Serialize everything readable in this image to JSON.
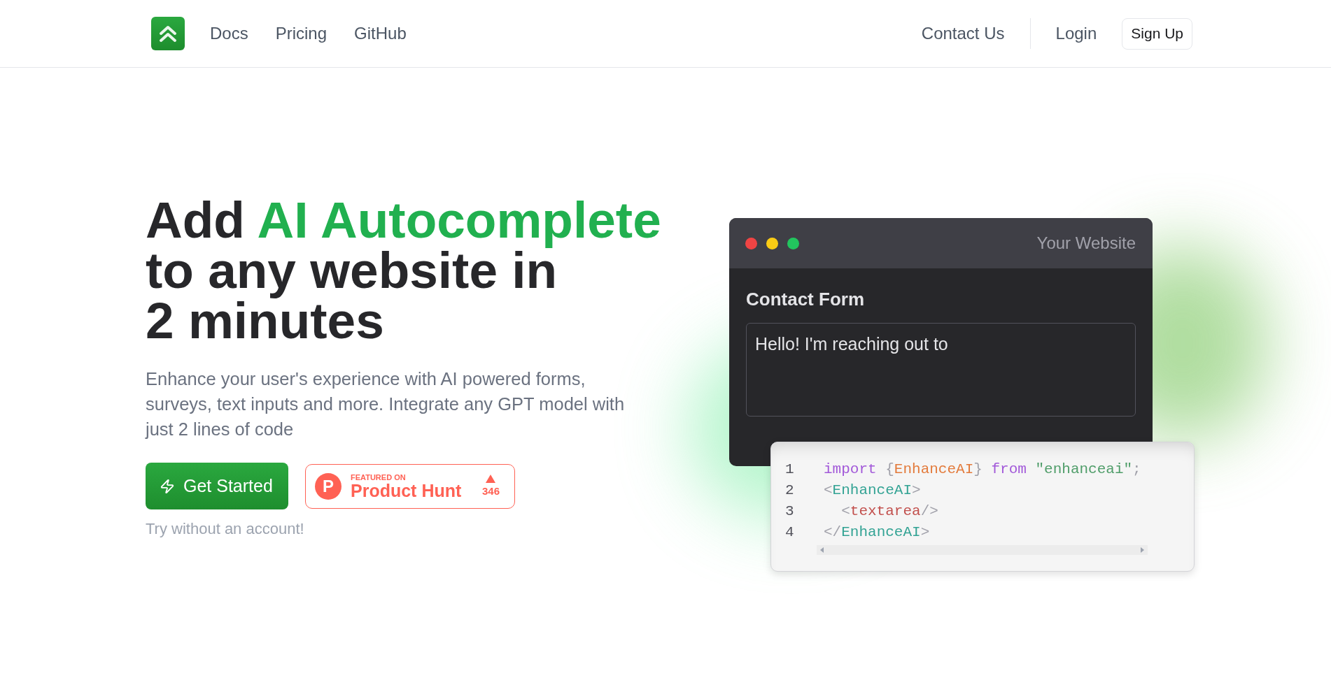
{
  "nav": {
    "links": [
      {
        "label": "Docs"
      },
      {
        "label": "Pricing"
      },
      {
        "label": "GitHub"
      }
    ],
    "contact": "Contact Us",
    "login": "Login",
    "signup": "Sign Up"
  },
  "hero": {
    "title_lines": [
      {
        "parts": [
          {
            "text": "Add ",
            "highlight": false
          },
          {
            "text": "AI Autocomplete",
            "highlight": true
          }
        ]
      },
      {
        "parts": [
          {
            "text": "to any website in",
            "highlight": false
          }
        ]
      },
      {
        "parts": [
          {
            "text": "2 minutes",
            "highlight": false
          }
        ]
      }
    ],
    "subtitle": "Enhance your user's experience with AI powered forms, surveys, text inputs and more. Integrate any GPT model with just 2 lines of code",
    "primary_button": "Get Started",
    "product_hunt": {
      "logo_letter": "P",
      "featured_label": "FEATURED ON",
      "name": "Product Hunt",
      "votes": "346"
    },
    "note": "Try without an account!"
  },
  "demo": {
    "window": {
      "dots": [
        {
          "color": "#ef4444"
        },
        {
          "color": "#facc15"
        },
        {
          "color": "#22c55e"
        }
      ],
      "title": "Your Website",
      "form_title": "Contact Form",
      "message": "Hello! I'm reaching out to"
    },
    "code": {
      "lines": [
        {
          "number": "1",
          "tokens": [
            {
              "kind": "keyword",
              "text": "import "
            },
            {
              "kind": "punct",
              "text": "{"
            },
            {
              "kind": "name",
              "text": "EnhanceAI"
            },
            {
              "kind": "punct",
              "text": "} "
            },
            {
              "kind": "keyword",
              "text": "from "
            },
            {
              "kind": "string",
              "text": "\"enhanceai\""
            },
            {
              "kind": "punct",
              "text": ";"
            }
          ]
        },
        {
          "number": "2",
          "tokens": [
            {
              "kind": "punct",
              "text": "<"
            },
            {
              "kind": "tag",
              "text": "EnhanceAI"
            },
            {
              "kind": "punct",
              "text": ">"
            }
          ]
        },
        {
          "number": "3",
          "tokens": [
            {
              "kind": "punct",
              "text": "  <"
            },
            {
              "kind": "element",
              "text": "textarea"
            },
            {
              "kind": "punct",
              "text": "/>"
            }
          ]
        },
        {
          "number": "4",
          "tokens": [
            {
              "kind": "punct",
              "text": "</"
            },
            {
              "kind": "tag",
              "text": "EnhanceAI"
            },
            {
              "kind": "punct",
              "text": ">"
            }
          ]
        }
      ]
    }
  }
}
